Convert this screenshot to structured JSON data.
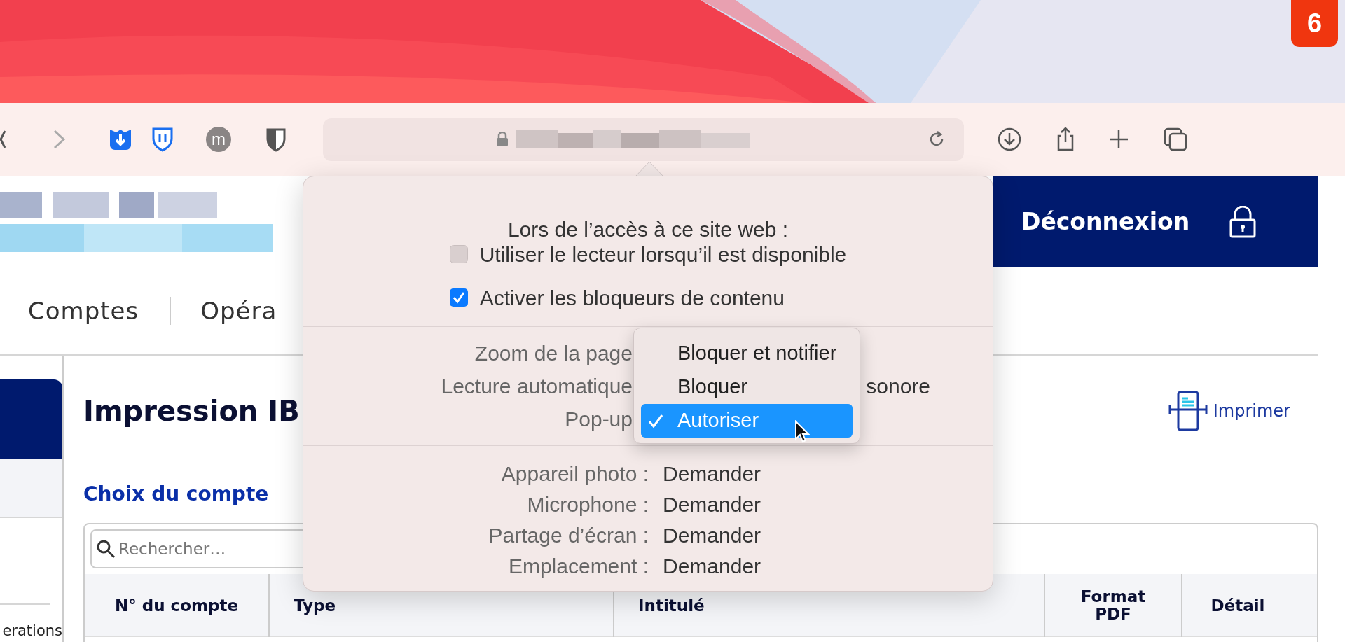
{
  "corner_badge": {
    "text": "6"
  },
  "toolbar": {
    "profile_initial": "m"
  },
  "header": {
    "logout": "Déconnexion"
  },
  "nav": {
    "items": [
      {
        "label": "Comptes"
      },
      {
        "label": "Opéra"
      }
    ]
  },
  "sidebar": {
    "bottom_label": "erations"
  },
  "content": {
    "title": "Impression IB",
    "print_link": "Imprimer",
    "section_title": "Choix du compte",
    "search": {
      "placeholder": "Rechercher…"
    },
    "table": {
      "columns": [
        "N° du compte",
        "Type",
        "Intitulé",
        "Format PDF",
        "Détail"
      ]
    }
  },
  "popover": {
    "title": "Lors de l’accès à ce site web :",
    "options": [
      {
        "label": "Utiliser le lecteur lorsqu’il est disponible",
        "checked": false
      },
      {
        "label": "Activer les bloqueurs de contenu",
        "checked": true
      }
    ],
    "settings": [
      {
        "label": "Zoom de la page"
      },
      {
        "label": "Lecture automatique",
        "value": "sonore"
      },
      {
        "label": "Pop-up"
      }
    ],
    "permissions": [
      {
        "label": "Appareil photo :",
        "value": "Demander"
      },
      {
        "label": "Microphone :",
        "value": "Demander"
      },
      {
        "label": "Partage d’écran :",
        "value": "Demander"
      },
      {
        "label": "Emplacement :",
        "value": "Demander"
      }
    ]
  },
  "popup_menu": {
    "items": [
      {
        "label": "Bloquer et notifier",
        "selected": false
      },
      {
        "label": "Bloquer",
        "selected": false
      },
      {
        "label": "Autoriser",
        "selected": true
      }
    ]
  }
}
